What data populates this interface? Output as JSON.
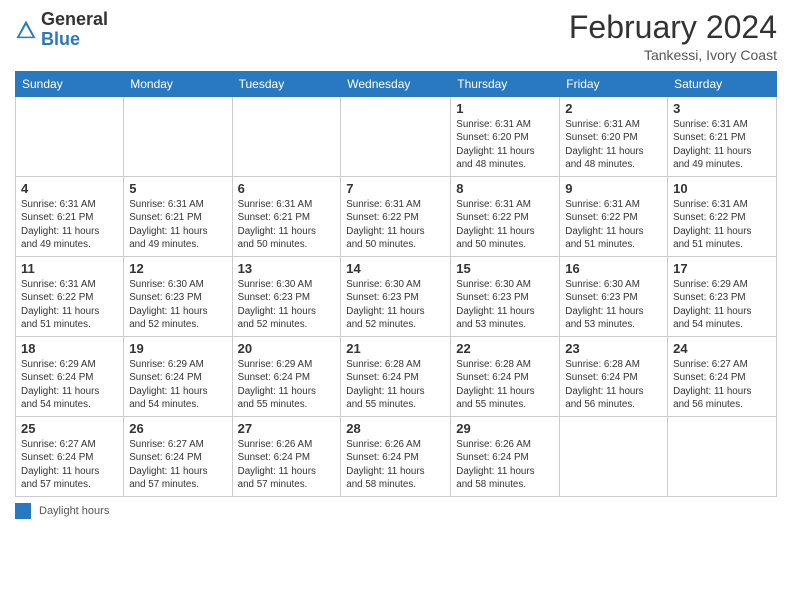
{
  "header": {
    "logo_general": "General",
    "logo_blue": "Blue",
    "month_title": "February 2024",
    "location": "Tankessi, Ivory Coast"
  },
  "days_of_week": [
    "Sunday",
    "Monday",
    "Tuesday",
    "Wednesday",
    "Thursday",
    "Friday",
    "Saturday"
  ],
  "weeks": [
    [
      {
        "day": "",
        "info": ""
      },
      {
        "day": "",
        "info": ""
      },
      {
        "day": "",
        "info": ""
      },
      {
        "day": "",
        "info": ""
      },
      {
        "day": "1",
        "info": "Sunrise: 6:31 AM\nSunset: 6:20 PM\nDaylight: 11 hours\nand 48 minutes."
      },
      {
        "day": "2",
        "info": "Sunrise: 6:31 AM\nSunset: 6:20 PM\nDaylight: 11 hours\nand 48 minutes."
      },
      {
        "day": "3",
        "info": "Sunrise: 6:31 AM\nSunset: 6:21 PM\nDaylight: 11 hours\nand 49 minutes."
      }
    ],
    [
      {
        "day": "4",
        "info": "Sunrise: 6:31 AM\nSunset: 6:21 PM\nDaylight: 11 hours\nand 49 minutes."
      },
      {
        "day": "5",
        "info": "Sunrise: 6:31 AM\nSunset: 6:21 PM\nDaylight: 11 hours\nand 49 minutes."
      },
      {
        "day": "6",
        "info": "Sunrise: 6:31 AM\nSunset: 6:21 PM\nDaylight: 11 hours\nand 50 minutes."
      },
      {
        "day": "7",
        "info": "Sunrise: 6:31 AM\nSunset: 6:22 PM\nDaylight: 11 hours\nand 50 minutes."
      },
      {
        "day": "8",
        "info": "Sunrise: 6:31 AM\nSunset: 6:22 PM\nDaylight: 11 hours\nand 50 minutes."
      },
      {
        "day": "9",
        "info": "Sunrise: 6:31 AM\nSunset: 6:22 PM\nDaylight: 11 hours\nand 51 minutes."
      },
      {
        "day": "10",
        "info": "Sunrise: 6:31 AM\nSunset: 6:22 PM\nDaylight: 11 hours\nand 51 minutes."
      }
    ],
    [
      {
        "day": "11",
        "info": "Sunrise: 6:31 AM\nSunset: 6:22 PM\nDaylight: 11 hours\nand 51 minutes."
      },
      {
        "day": "12",
        "info": "Sunrise: 6:30 AM\nSunset: 6:23 PM\nDaylight: 11 hours\nand 52 minutes."
      },
      {
        "day": "13",
        "info": "Sunrise: 6:30 AM\nSunset: 6:23 PM\nDaylight: 11 hours\nand 52 minutes."
      },
      {
        "day": "14",
        "info": "Sunrise: 6:30 AM\nSunset: 6:23 PM\nDaylight: 11 hours\nand 52 minutes."
      },
      {
        "day": "15",
        "info": "Sunrise: 6:30 AM\nSunset: 6:23 PM\nDaylight: 11 hours\nand 53 minutes."
      },
      {
        "day": "16",
        "info": "Sunrise: 6:30 AM\nSunset: 6:23 PM\nDaylight: 11 hours\nand 53 minutes."
      },
      {
        "day": "17",
        "info": "Sunrise: 6:29 AM\nSunset: 6:23 PM\nDaylight: 11 hours\nand 54 minutes."
      }
    ],
    [
      {
        "day": "18",
        "info": "Sunrise: 6:29 AM\nSunset: 6:24 PM\nDaylight: 11 hours\nand 54 minutes."
      },
      {
        "day": "19",
        "info": "Sunrise: 6:29 AM\nSunset: 6:24 PM\nDaylight: 11 hours\nand 54 minutes."
      },
      {
        "day": "20",
        "info": "Sunrise: 6:29 AM\nSunset: 6:24 PM\nDaylight: 11 hours\nand 55 minutes."
      },
      {
        "day": "21",
        "info": "Sunrise: 6:28 AM\nSunset: 6:24 PM\nDaylight: 11 hours\nand 55 minutes."
      },
      {
        "day": "22",
        "info": "Sunrise: 6:28 AM\nSunset: 6:24 PM\nDaylight: 11 hours\nand 55 minutes."
      },
      {
        "day": "23",
        "info": "Sunrise: 6:28 AM\nSunset: 6:24 PM\nDaylight: 11 hours\nand 56 minutes."
      },
      {
        "day": "24",
        "info": "Sunrise: 6:27 AM\nSunset: 6:24 PM\nDaylight: 11 hours\nand 56 minutes."
      }
    ],
    [
      {
        "day": "25",
        "info": "Sunrise: 6:27 AM\nSunset: 6:24 PM\nDaylight: 11 hours\nand 57 minutes."
      },
      {
        "day": "26",
        "info": "Sunrise: 6:27 AM\nSunset: 6:24 PM\nDaylight: 11 hours\nand 57 minutes."
      },
      {
        "day": "27",
        "info": "Sunrise: 6:26 AM\nSunset: 6:24 PM\nDaylight: 11 hours\nand 57 minutes."
      },
      {
        "day": "28",
        "info": "Sunrise: 6:26 AM\nSunset: 6:24 PM\nDaylight: 11 hours\nand 58 minutes."
      },
      {
        "day": "29",
        "info": "Sunrise: 6:26 AM\nSunset: 6:24 PM\nDaylight: 11 hours\nand 58 minutes."
      },
      {
        "day": "",
        "info": ""
      },
      {
        "day": "",
        "info": ""
      }
    ]
  ],
  "footer": {
    "legend_label": "Daylight hours"
  }
}
